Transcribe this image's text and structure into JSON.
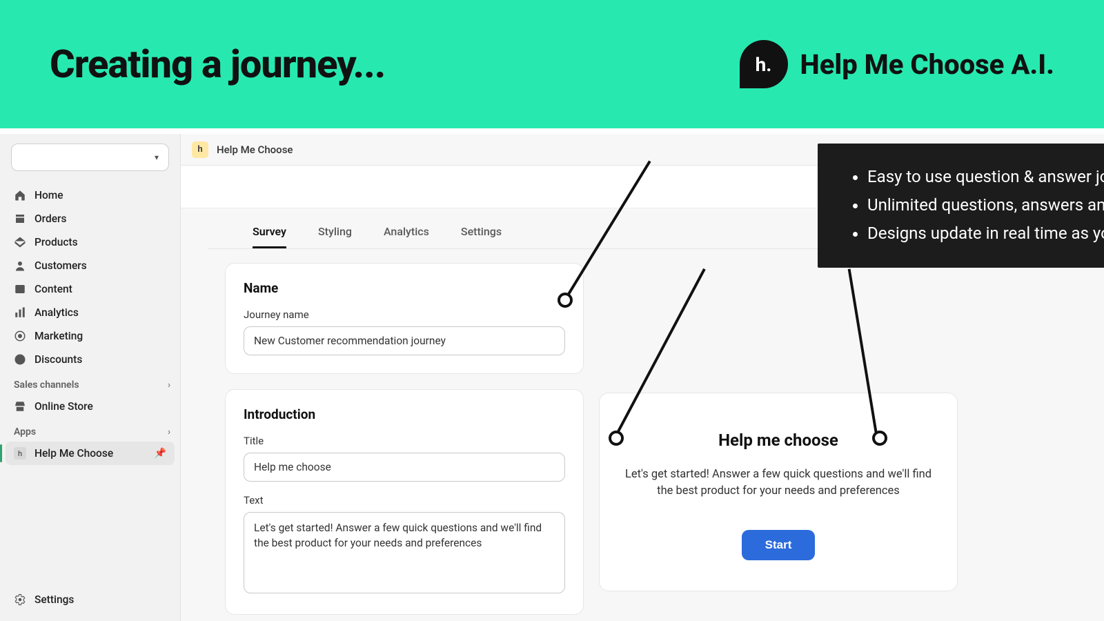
{
  "hero": {
    "title": "Creating a journey...",
    "brand_text": "Help Me Choose A.I.",
    "logo_text": "h."
  },
  "sidebar": {
    "nav": [
      {
        "label": "Home",
        "icon": "⌂"
      },
      {
        "label": "Orders",
        "icon": ""
      },
      {
        "label": "Products",
        "icon": ""
      },
      {
        "label": "Customers",
        "icon": ""
      },
      {
        "label": "Content",
        "icon": ""
      },
      {
        "label": "Analytics",
        "icon": ""
      },
      {
        "label": "Marketing",
        "icon": ""
      },
      {
        "label": "Discounts",
        "icon": ""
      }
    ],
    "section_sales": "Sales channels",
    "online_store": "Online Store",
    "section_apps": "Apps",
    "app_item": "Help Me Choose",
    "app_icon_text": "h",
    "settings": "Settings"
  },
  "topbar": {
    "app_badge": "h",
    "title": "Help Me Choose"
  },
  "tabs": {
    "survey": "Survey",
    "styling": "Styling",
    "analytics": "Analytics",
    "settings": "Settings"
  },
  "name_card": {
    "heading": "Name",
    "label": "Journey name",
    "value": "New Customer recommendation journey"
  },
  "intro_card": {
    "heading": "Introduction",
    "title_label": "Title",
    "title_value": "Help me choose",
    "text_label": "Text",
    "text_value": "Let's get started! Answer a few quick questions and we'll find the best product for your needs and preferences"
  },
  "preview": {
    "title": "Help me choose",
    "text": "Let's get started! Answer a few quick questions and we'll find the best product for your needs and preferences",
    "button": "Start"
  },
  "callout": {
    "items": [
      "Easy to use question & answer journey editor",
      "Unlimited questions, answers and products",
      "Designs update in real time as you edit"
    ]
  }
}
